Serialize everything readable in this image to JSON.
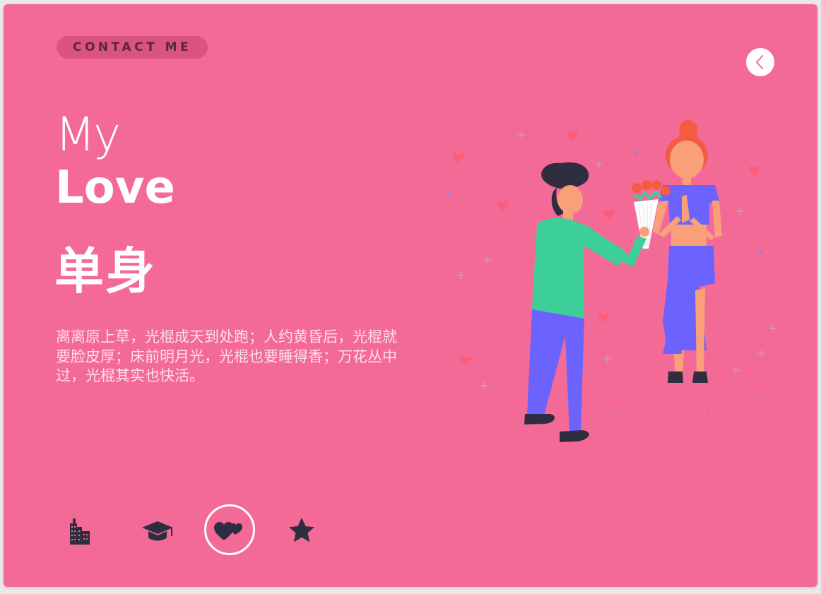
{
  "header": {
    "contact_label": "CONTACT ME"
  },
  "hero": {
    "title_line1": "My",
    "title_line2": "Love",
    "title_cn": "单身",
    "description": "离离原上草，光棍成天到处跑；人约黄昏后，光棍就要脸皮厚；床前明月光，光棍也要睡得香；万花丛中过，光棍其实也快活。"
  },
  "tabs": [
    {
      "icon": "city-icon",
      "active": false
    },
    {
      "icon": "graduation-cap-icon",
      "active": false
    },
    {
      "icon": "hearts-icon",
      "active": true
    },
    {
      "icon": "star-icon",
      "active": false
    }
  ],
  "colors": {
    "card_background": "#f46a97",
    "pill_background": "#db5382",
    "shirt_green": "#3ccf9a",
    "pants_purple": "#6c63ff",
    "hair_orange": "#f45b41",
    "skin": "#f9a07a"
  },
  "illustration": {
    "subject": "man-giving-bouquet-to-woman"
  }
}
